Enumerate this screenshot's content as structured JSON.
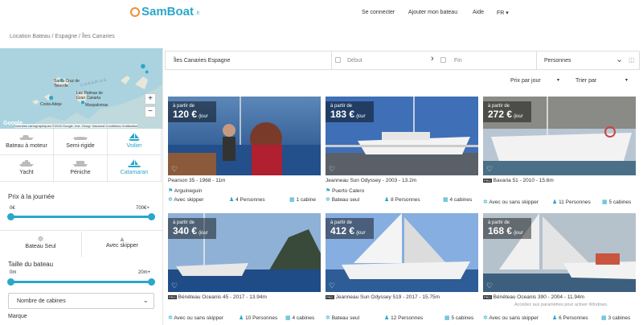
{
  "header": {
    "logo_text": "SamBoat",
    "logo_tld": ".fr",
    "nav": [
      "Se connecter",
      "Ajouter mon bateau",
      "Aide",
      "FR ▾"
    ]
  },
  "breadcrumb": "Location Bateau / Espagne / Îles Canaries",
  "map": {
    "labels": [
      "Santa Cruz de Tenerife",
      "CANARIAS",
      "Las Palmas de Gran Canaria",
      "Costa Adeje",
      "Maspalomas"
    ],
    "zoom_in": "+",
    "zoom_out": "−",
    "attribution_logo": "Google",
    "attribution": "Données cartographiques ©2018 Google, Inst. Geogr. Nacional   Conditions d'utilisation"
  },
  "boat_types": [
    {
      "label": "Bateau à moteur",
      "selected": false
    },
    {
      "label": "Semi-rigide",
      "selected": false
    },
    {
      "label": "Voilier",
      "selected": true
    },
    {
      "label": "Yacht",
      "selected": false
    },
    {
      "label": "Péniche",
      "selected": false
    },
    {
      "label": "Catamaran",
      "selected": true
    }
  ],
  "price_filter": {
    "title": "Prix à la journée",
    "min_label": "0€",
    "max_label": "700€+",
    "min_value": 0,
    "max_value": 700
  },
  "skipper_options": [
    "Bateau Seul",
    "Avec skipper"
  ],
  "size_filter": {
    "title": "Taille du bateau",
    "min_label": "0m",
    "max_label": "20m+",
    "min_value": 0,
    "max_value": 20
  },
  "cabins_select": "Nombre de cabines",
  "brand_title": "Marque",
  "search": {
    "destination": "Îles Canaries Espagne",
    "start_placeholder": "Début",
    "end_placeholder": "Fin",
    "persons": "Personnes"
  },
  "sort": {
    "price": "Prix par jour",
    "order": "Trier par"
  },
  "listings": [
    {
      "from": "à partir de",
      "price": "120 €",
      "per": "/jour",
      "title": "Pearson 35 - 1968 - 11m",
      "pro": false,
      "location": "Arguineguin",
      "features": [
        "Avec skipper",
        "4 Personnes",
        "1 cabine"
      ]
    },
    {
      "from": "à partir de",
      "price": "183 €",
      "per": "/jour",
      "title": "Jeanneau Sun Odyssey - 2003 - 13.2m",
      "pro": false,
      "location": "Puerto Calero",
      "features": [
        "Bateau seul",
        "8 Personnes",
        "4 cabines"
      ]
    },
    {
      "from": "à partir de",
      "price": "272 €",
      "per": "/jour",
      "title": "Bavaria 51 - 2010 - 15.6m",
      "pro": true,
      "location": "",
      "features": [
        "Avec ou sans skipper",
        "11 Personnes",
        "5 cabines"
      ]
    },
    {
      "from": "à partir de",
      "price": "340 €",
      "per": "/jour",
      "title": "Bénéteau Oceanis 45 - 2017 - 13.94m",
      "pro": true,
      "location": "",
      "features": [
        "Avec ou sans skipper",
        "10 Personnes",
        "4 cabines"
      ]
    },
    {
      "from": "à partir de",
      "price": "412 €",
      "per": "/jour",
      "title": "Jeanneau Sun Odyssey 519 - 2017 - 15.75m",
      "pro": true,
      "location": "",
      "features": [
        "Bateau seul",
        "12 Personnes",
        "5 cabines"
      ]
    },
    {
      "from": "à partir de",
      "price": "168 €",
      "per": "/jour",
      "title": "Bénéteau Oceanis 390 - 2004 - 11.94m",
      "pro": true,
      "location": "",
      "features": [
        "Avec ou sans skipper",
        "6 Personnes",
        "3 cabines"
      ]
    }
  ],
  "activation_text": "Accédez aux paramètres pour activer Windows.",
  "colors": {
    "accent": "#2aa7c9",
    "logo_orange": "#f28c38"
  }
}
